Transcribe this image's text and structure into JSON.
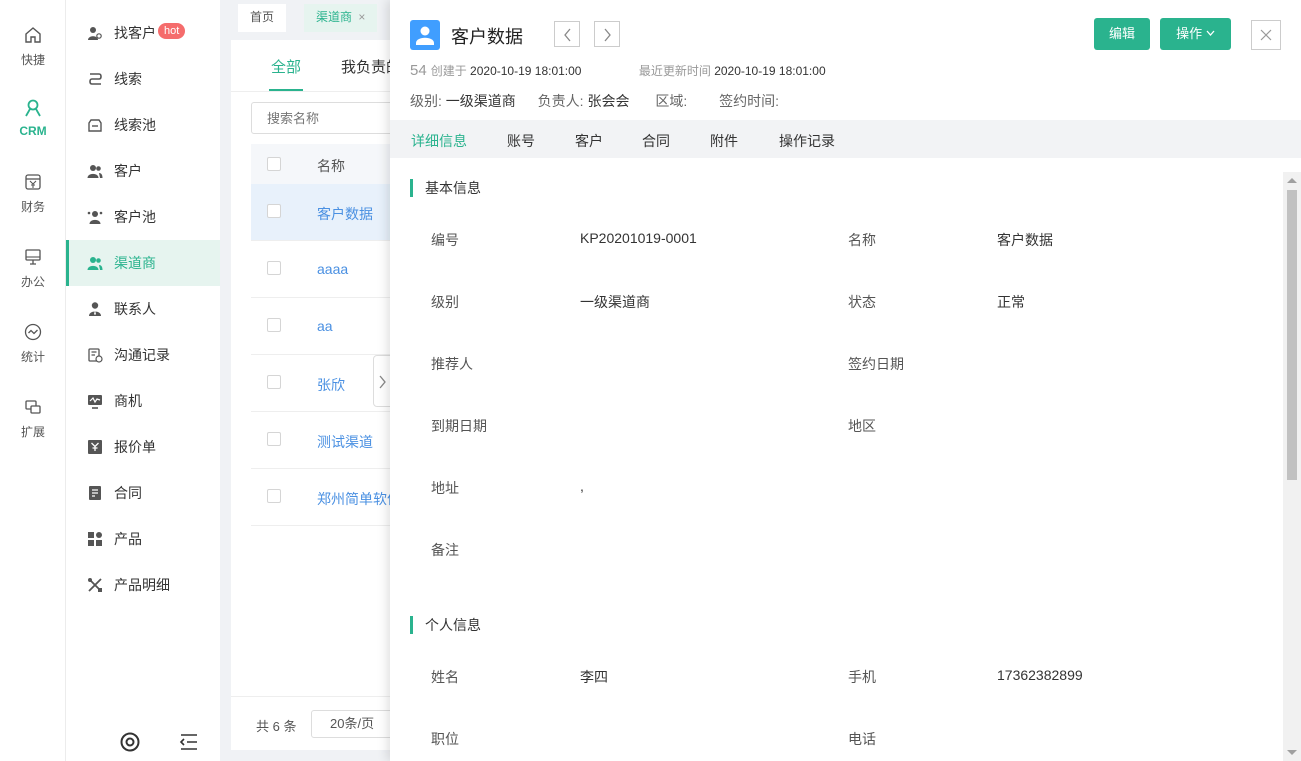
{
  "rail": [
    {
      "label": "快捷",
      "icon": "home-icon"
    },
    {
      "label": "CRM",
      "icon": "crm-person-icon",
      "active": true
    },
    {
      "label": "财务",
      "icon": "finance-yen-icon"
    },
    {
      "label": "办公",
      "icon": "monitor-icon"
    },
    {
      "label": "统计",
      "icon": "stats-chart-icon"
    },
    {
      "label": "扩展",
      "icon": "extend-icon"
    }
  ],
  "menu": {
    "items": [
      {
        "label": "找客户",
        "badge": "hot"
      },
      {
        "label": "线索"
      },
      {
        "label": "线索池"
      },
      {
        "label": "客户"
      },
      {
        "label": "客户池"
      },
      {
        "label": "渠道商",
        "active": true
      },
      {
        "label": "联系人"
      },
      {
        "label": "沟通记录"
      },
      {
        "label": "商机"
      },
      {
        "label": "报价单"
      },
      {
        "label": "合同"
      },
      {
        "label": "产品"
      },
      {
        "label": "产品明细"
      }
    ]
  },
  "page_tabs": [
    {
      "label": "首页"
    },
    {
      "label": "渠道商",
      "closable": "×",
      "active": true
    }
  ],
  "list": {
    "tabs": [
      "全部",
      "我负责的"
    ],
    "search_placeholder": "搜索名称",
    "header_name": "名称",
    "rows": [
      "客户数据",
      "aaaa",
      "aa",
      "张欣",
      "测试渠道",
      "郑州简单软件"
    ],
    "total": "共 6 条",
    "page_size": "20条/页"
  },
  "detail": {
    "title": "客户数据",
    "edit_label": "编辑",
    "action_label": "操作",
    "id_num": "54",
    "created_label": "创建于",
    "created_at": "2020-10-19 18:01:00",
    "updated_label": "最近更新时间",
    "updated_at": "2020-10-19 18:01:00",
    "level_label": "级别:",
    "level": "一级渠道商",
    "owner_label": "负责人:",
    "owner": "张会会",
    "region_label": "区域:",
    "sign_time_label": "签约时间:",
    "tabs": [
      "详细信息",
      "账号",
      "客户",
      "合同",
      "附件",
      "操作记录"
    ],
    "basic_title": "基本信息",
    "basic_fields": {
      "code_label": "编号",
      "code": "KP20201019-0001",
      "name_label": "名称",
      "name": "客户数据",
      "level_label": "级别",
      "level": "一级渠道商",
      "status_label": "状态",
      "status": "正常",
      "referrer_label": "推荐人",
      "sign_date_label": "签约日期",
      "expire_label": "到期日期",
      "area_label": "地区",
      "address_label": "地址",
      "address": ",",
      "remark_label": "备注"
    },
    "personal_title": "个人信息",
    "personal_fields": {
      "person_label": "姓名",
      "person": "李四",
      "mobile_label": "手机",
      "mobile": "17362382899",
      "position_label": "职位",
      "phone_label": "电话"
    }
  },
  "colors": {
    "accent": "#2ab38e",
    "link": "#4a90e2",
    "hot": "#f56c6c",
    "avatar": "#409eff"
  }
}
